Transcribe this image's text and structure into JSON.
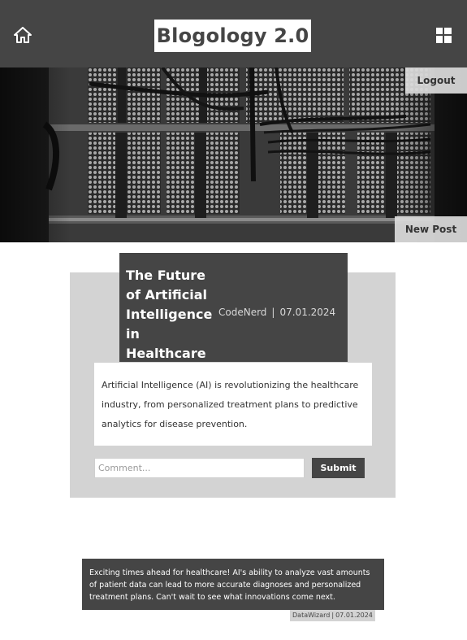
{
  "header": {
    "title": "Blogology 2.0",
    "home_icon": "home-icon",
    "menu_icon": "grid-icon"
  },
  "hero": {
    "logout_label": "Logout",
    "new_post_label": "New Post"
  },
  "post": {
    "title": "The Future of Artificial Intelligence in Healthcare",
    "author": "CodeNerd",
    "separator": "|",
    "date": "07.01.2024",
    "body": "Artificial Intelligence (AI) is revolutionizing the healthcare industry, from personalized treatment plans to predictive analytics for disease prevention.",
    "comment_placeholder": "Comment...",
    "comment_value": "",
    "submit_label": "Submit"
  },
  "comments": [
    {
      "text": "Exciting times ahead for healthcare! AI's ability to analyze vast amounts of patient data can lead to more accurate diagnoses and personalized treatment plans. Can't wait to see what innovations come next.",
      "author": "DataWizard",
      "separator": "|",
      "date": "07.01.2024"
    }
  ],
  "colors": {
    "header_bg": "#454545",
    "card_bg": "#d3d3d3",
    "text_light": "#ffffff",
    "button_dark": "#454545"
  }
}
